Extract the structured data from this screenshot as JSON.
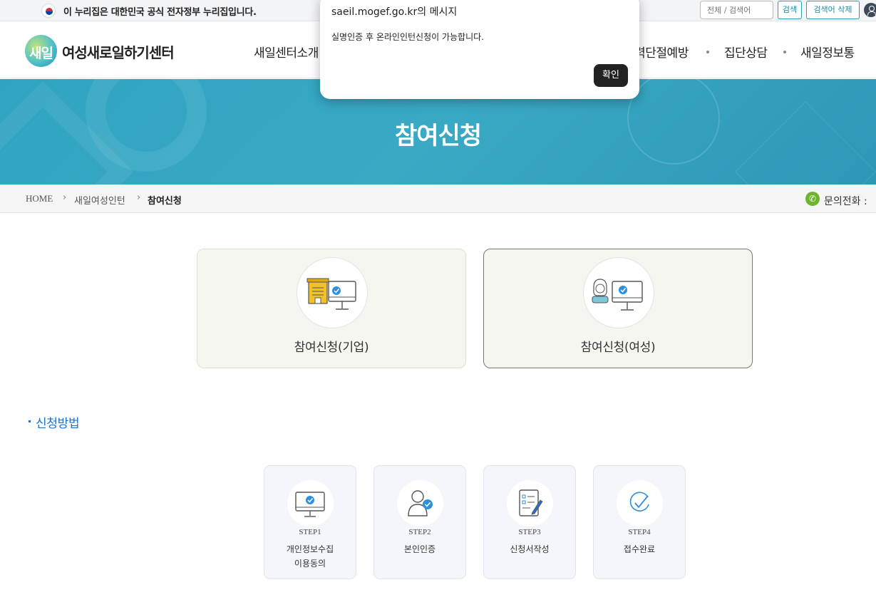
{
  "gov_banner": {
    "text": "이 누리집은 대한민국 공식 전자정부 누리집입니다.",
    "search_placeholder": "전체 / 검색어",
    "search_button": "검색",
    "search_clear_button": "검색어 삭제"
  },
  "header": {
    "logo_mark": "새일",
    "logo_text": "여성새로일하기센터",
    "nav": [
      "새일센터소개",
      "경력단절예방",
      "집단상담",
      "새일정보통"
    ]
  },
  "hero": {
    "title": "참여신청"
  },
  "breadcrumb": {
    "home": "HOME",
    "items": [
      "새일여성인턴",
      "참여신청"
    ],
    "phone_label": "문의전화 :"
  },
  "choices": [
    {
      "label": "참여신청(기업)",
      "icon": "company-computer-icon"
    },
    {
      "label": "참여신청(여성)",
      "icon": "woman-computer-icon"
    }
  ],
  "section": {
    "title": "신청방법"
  },
  "steps": [
    {
      "num": "STEP1",
      "label_line1": "개인정보수집",
      "label_line2": "이용동의",
      "icon": "monitor-check-icon"
    },
    {
      "num": "STEP2",
      "label_line1": "본인인증",
      "label_line2": "",
      "icon": "person-check-icon"
    },
    {
      "num": "STEP3",
      "label_line1": "신청서작성",
      "label_line2": "",
      "icon": "form-write-icon"
    },
    {
      "num": "STEP4",
      "label_line1": "접수완료",
      "label_line2": "",
      "icon": "checkmark-icon"
    }
  ],
  "dialog": {
    "title": "saeil.mogef.go.kr의 메시지",
    "message": "실명인증 후 온라인인턴신청이 가능합니다.",
    "ok_button": "확인"
  },
  "colors": {
    "hero": "#34a6c3",
    "accent_blue": "#1a73c7",
    "step_card_bg": "#f4f6fb",
    "choice_card_bg": "#f5f6ef",
    "phone_green": "#6cb52d",
    "dialog_button": "#222222"
  }
}
